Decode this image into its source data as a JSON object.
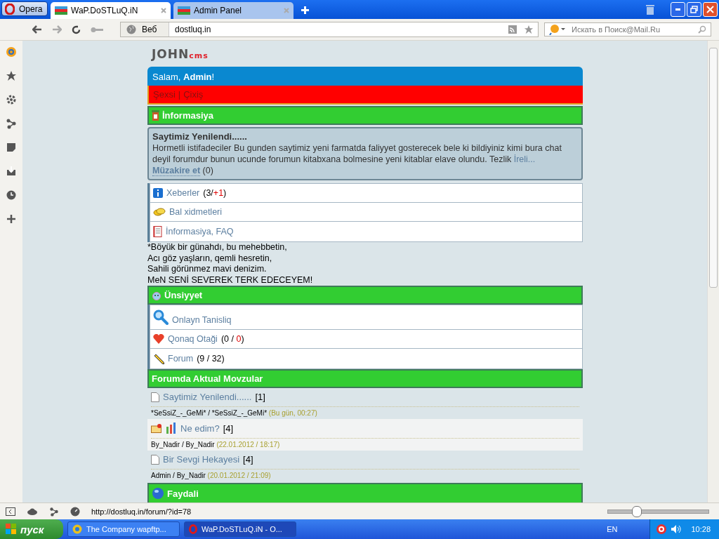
{
  "browser": {
    "menu_button": "Opera",
    "tabs": [
      {
        "title": "WaP.DoSTLuQ.iN",
        "selected": true
      },
      {
        "title": "Admin Panel",
        "selected": false
      }
    ],
    "address": {
      "scheme_label": "Веб",
      "url": "dostluq.in"
    },
    "search": {
      "placeholder": "Искать в Поиск@Mail.Ru"
    }
  },
  "page": {
    "logo": {
      "main": "JOHN",
      "sub": "cms"
    },
    "greeting": "Salam, **Admin**!",
    "user_links": [
      "Şexsi",
      "Çixiş"
    ],
    "user_links_separator": "|",
    "info_header": "İnformasiya",
    "news": {
      "title": "Saytimiz Yenilendi......",
      "body": "Hormetli istifadeciler Bu gunden saytimiz yeni farmatda faliyyet gosterecek bele ki bildiyiniz kimi bura chat deyil forumdur bunun ucunde forumun kitabxana bolmesine yeni kitablar elave olundu. Tezlik",
      "more_link": "İreli...",
      "discuss_link": "Müzakire et",
      "discuss_count": "(0)"
    },
    "info_links": [
      {
        "label": "Xeberler",
        "parts": [
          {
            "text": "(3/",
            "highlight": false
          },
          {
            "text": "+1",
            "highlight": true
          },
          {
            "text": ")",
            "highlight": false
          }
        ]
      },
      {
        "label": "Bal xidmetleri"
      },
      {
        "label": "İnformasiya, FAQ"
      }
    ],
    "poem": [
      "*Böyük bir günahdı, bu mehebbetin,",
      "Acı göz yaşların, qemli hesretin,",
      "Sahili görünmez mavi denizim.",
      "MeN SENİ SEVEREK TERK EDECEYEM!"
    ],
    "communication": {
      "title": "Ünsiyyet",
      "links": [
        {
          "label": "Onlayn Tanisliq"
        },
        {
          "label": "Qonaq Otaği",
          "parts": [
            {
              "text": "(0 / ",
              "highlight": false
            },
            {
              "text": "0",
              "highlight": true
            },
            {
              "text": ")",
              "highlight": false
            }
          ]
        },
        {
          "label": "Forum",
          "parts": [
            {
              "text": "(9 / 32)",
              "highlight": false
            }
          ]
        }
      ]
    },
    "forum": {
      "title": "Forumda Aktual Movzular",
      "topics": [
        {
          "kind": "plain",
          "title": "Saytimiz Yenilendi......",
          "count": "[1]",
          "authors": "*SeSsiZ_-_GeMi* / *SeSsiZ_-_GeMi*",
          "time": "(Bu gün, 00:27)"
        },
        {
          "kind": "poll",
          "title": "Ne edim?",
          "count": "[4]",
          "authors": "By_Nadir / By_Nadir",
          "time": "(22.01.2012 / 18:17)"
        },
        {
          "kind": "plain",
          "title": "Bir Sevgi Hekayesi",
          "count": "[4]",
          "authors": "Admin / By_Nadir",
          "time": "(20.01.2012 / 21:09)"
        }
      ]
    },
    "useful_header": "Faydali"
  },
  "status_bar": {
    "url": "http://dostluq.in/forum/?id=78",
    "zoom": {
      "level": 0.28
    }
  },
  "taskbar": {
    "start": "пуск",
    "tasks": [
      {
        "title": "The Company wapftp...",
        "selected": false
      },
      {
        "title": "WaP.DoSTLuQ.iN - O...",
        "selected": true
      }
    ],
    "language": "EN",
    "clock": "10:28"
  }
}
